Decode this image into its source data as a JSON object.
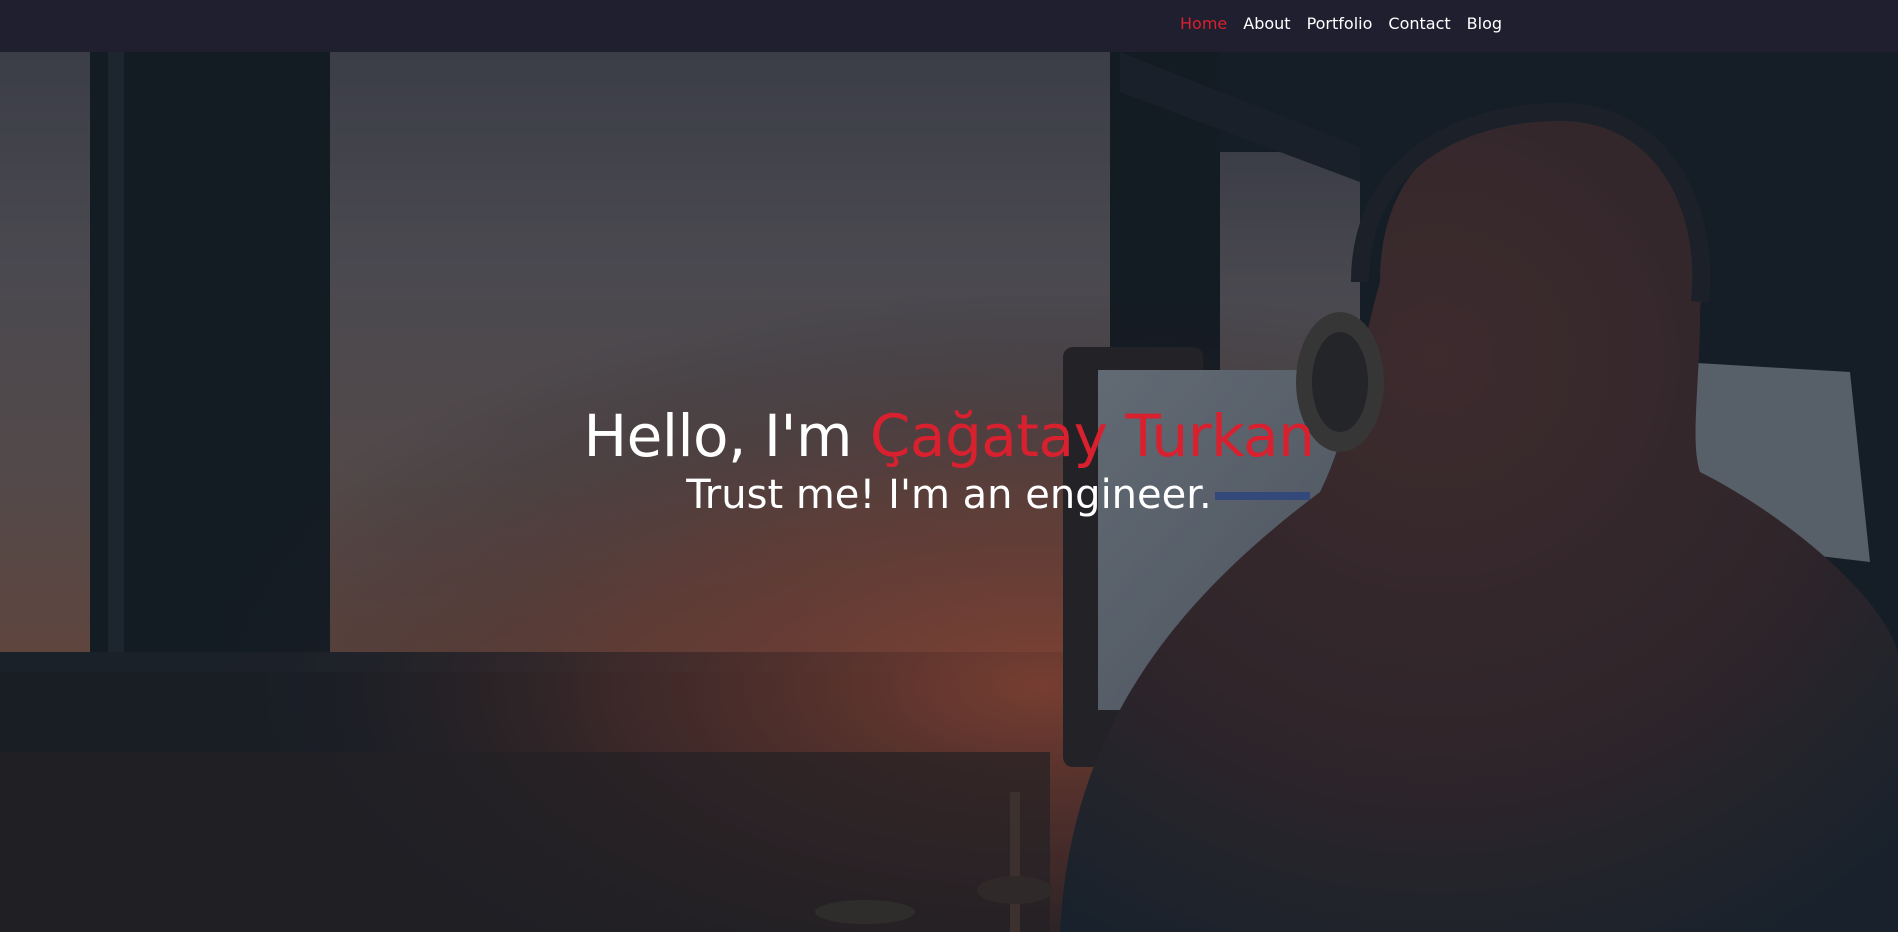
{
  "nav": {
    "items": [
      {
        "label": "Home",
        "active": true
      },
      {
        "label": "About",
        "active": false
      },
      {
        "label": "Portfolio",
        "active": false
      },
      {
        "label": "Contact",
        "active": false
      },
      {
        "label": "Blog",
        "active": false
      }
    ]
  },
  "hero": {
    "greeting": "Hello, I'm ",
    "name": "Çağatay Turkan",
    "subtitle": "Trust me! I'm an engineer.",
    "background_description": "person-with-headphones-at-computer-sunset-window"
  },
  "colors": {
    "accent": "#d9202f",
    "navbar_bg": "#201f30",
    "text": "#ffffff"
  }
}
